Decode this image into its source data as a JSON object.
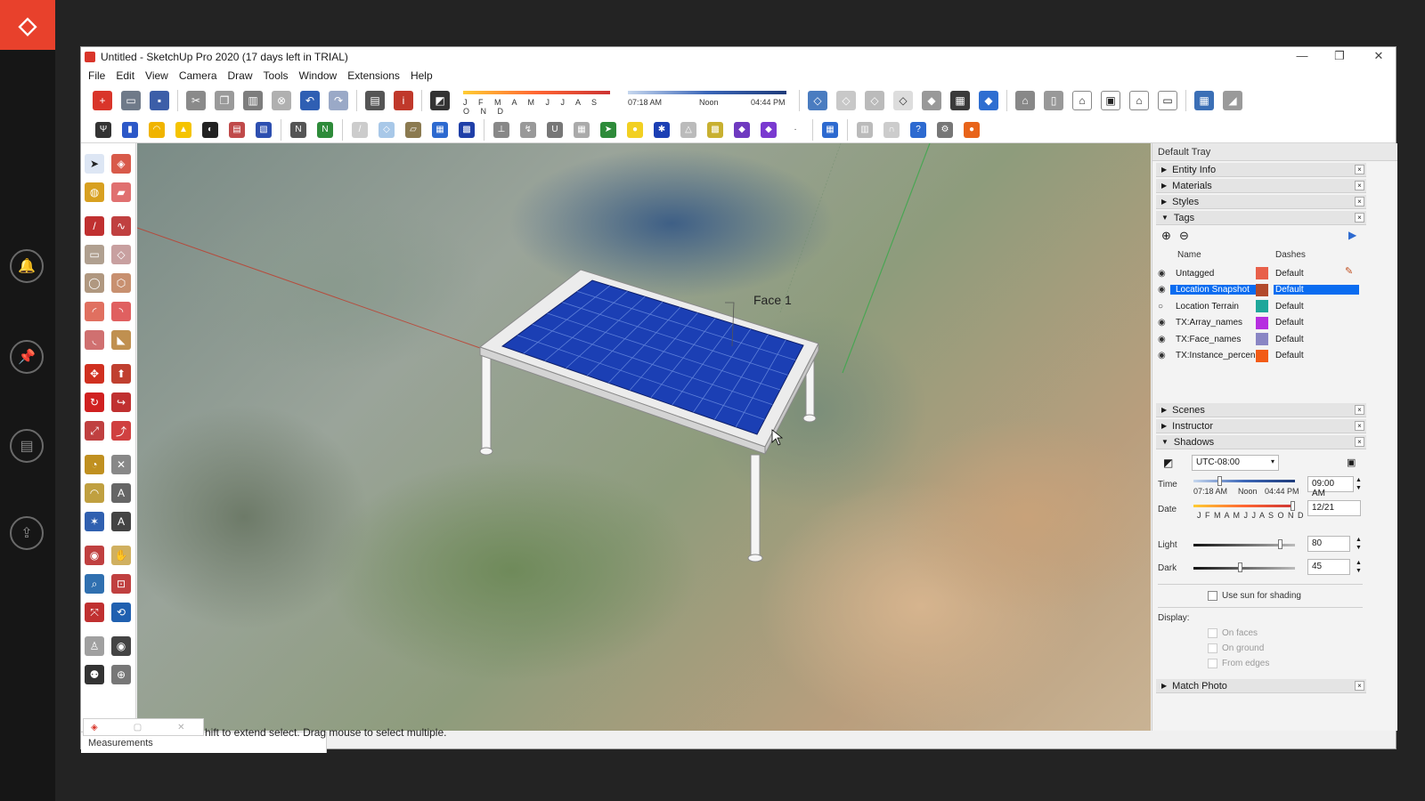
{
  "window": {
    "title": "Untitled - SketchUp Pro 2020 (17 days left in TRIAL)",
    "minimize": "—",
    "maximize": "❐",
    "close": "✕"
  },
  "menu": [
    "File",
    "Edit",
    "View",
    "Camera",
    "Draw",
    "Tools",
    "Window",
    "Extensions",
    "Help"
  ],
  "shadow_toolbar": {
    "months": "J F M A M J J A S O N D",
    "time_start": "07:18 AM",
    "time_mid": "Noon",
    "time_end": "04:44 PM"
  },
  "viewport": {
    "face_label": "Face 1"
  },
  "tray": {
    "title": "Default Tray",
    "panels_top": [
      "Entity Info",
      "Materials",
      "Styles",
      "Tags"
    ],
    "tags": {
      "col_name": "Name",
      "col_dashes": "Dashes",
      "rows": [
        {
          "name": "Untagged",
          "dash": "Default",
          "color": "#e8604a",
          "visible": true,
          "selected": false
        },
        {
          "name": "Location Snapshot",
          "dash": "Default",
          "color": "#b24a2c",
          "visible": true,
          "selected": true
        },
        {
          "name": "Location Terrain",
          "dash": "Default",
          "color": "#1fa79a",
          "visible": false,
          "selected": false
        },
        {
          "name": "TX:Array_names",
          "dash": "Default",
          "color": "#b62fe0",
          "visible": true,
          "selected": false
        },
        {
          "name": "TX:Face_names",
          "dash": "Default",
          "color": "#8a86c4",
          "visible": true,
          "selected": false
        },
        {
          "name": "TX:Instance_percen",
          "dash": "Default",
          "color": "#f25b16",
          "visible": true,
          "selected": false
        }
      ]
    },
    "panels_bottom": [
      "Scenes",
      "Instructor",
      "Shadows"
    ],
    "shadows": {
      "timezone": "UTC-08:00",
      "time_label": "Time",
      "time_start": "07:18 AM",
      "time_mid": "Noon",
      "time_end": "04:44 PM",
      "time_value": "09:00 AM",
      "date_label": "Date",
      "months": "J F M A M J J A S O N D",
      "date_value": "12/21",
      "light_label": "Light",
      "light_value": "80",
      "dark_label": "Dark",
      "dark_value": "45",
      "use_sun": "Use sun for shading",
      "display_label": "Display:",
      "on_faces": "On faces",
      "on_ground": "On ground",
      "from_edges": "From edges"
    },
    "match_photo": "Match Photo"
  },
  "measurements_label": "Measurements",
  "status_text": "hift to extend select. Drag mouse to select multiple.",
  "colors": {
    "accent_red": "#e8412c",
    "selection_blue": "#0a6cf0",
    "panel_blue": "#1b3fb4"
  }
}
